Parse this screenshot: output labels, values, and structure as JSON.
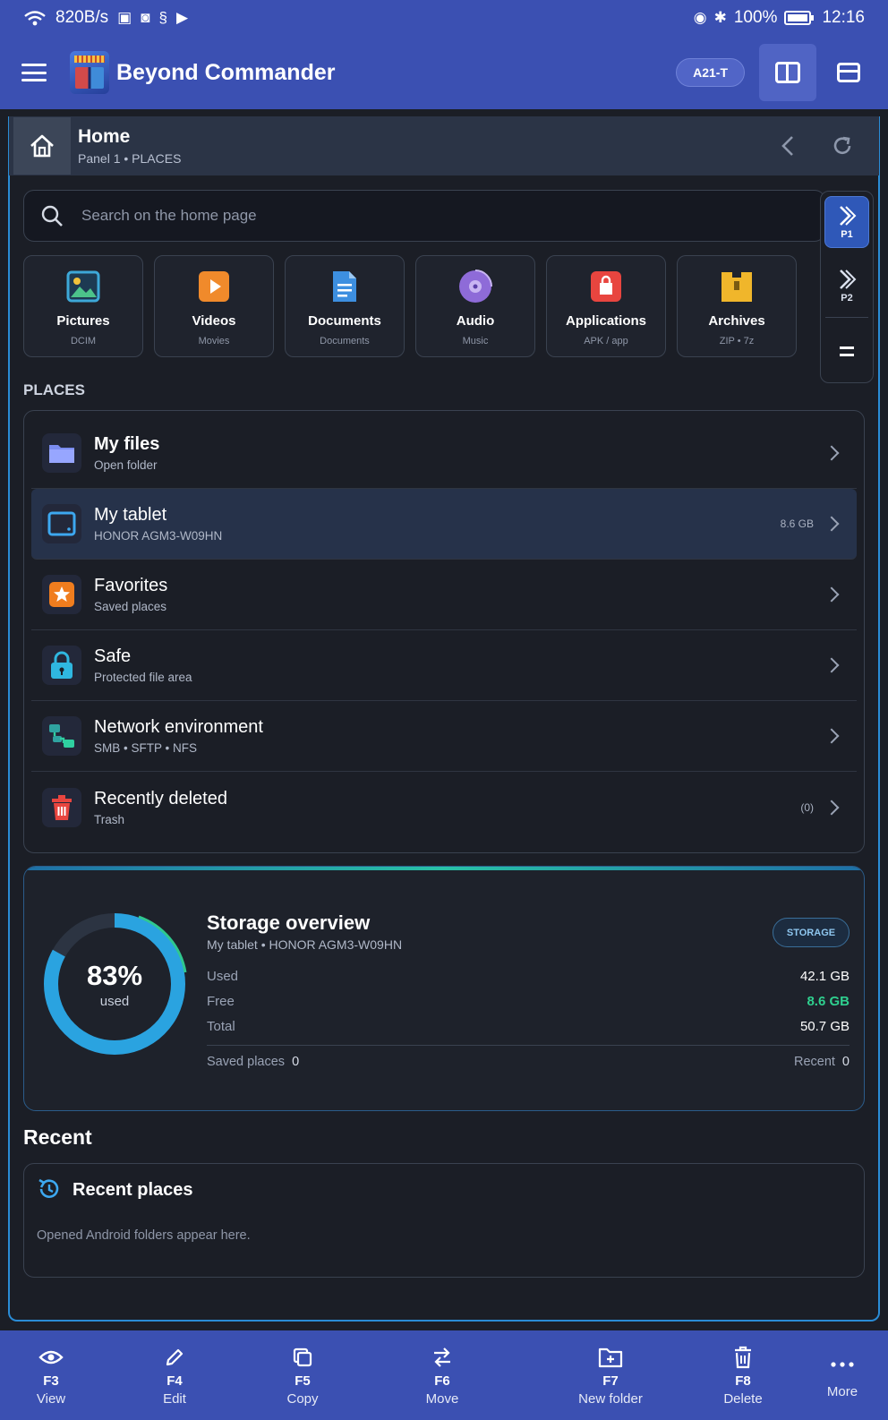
{
  "status_bar": {
    "net_speed": "820B/s",
    "battery": "100%",
    "time": "12:16"
  },
  "app": {
    "title": "Beyond Commander",
    "device_chip": "A21-T"
  },
  "panel": {
    "title": "Home",
    "subtitle": "Panel 1 • PLACES"
  },
  "search": {
    "placeholder": "Search on the home page"
  },
  "side_buttons": {
    "p1": "P1",
    "p2": "P2"
  },
  "tiles": [
    {
      "label": "Pictures",
      "sub": "DCIM",
      "icon": "pictures-icon",
      "color": "#3da8d8"
    },
    {
      "label": "Videos",
      "sub": "Movies",
      "icon": "videos-icon",
      "color": "#f08a2b"
    },
    {
      "label": "Documents",
      "sub": "Documents",
      "icon": "documents-icon",
      "color": "#3d8fe0"
    },
    {
      "label": "Audio",
      "sub": "Music",
      "icon": "audio-icon",
      "color": "#8e6bd8"
    },
    {
      "label": "Applications",
      "sub": "APK / app",
      "icon": "applications-icon",
      "color": "#e8453f"
    },
    {
      "label": "Archives",
      "sub": "ZIP • 7z",
      "icon": "archives-icon",
      "color": "#f0b62b"
    }
  ],
  "places_label": "PLACES",
  "places": [
    {
      "title": "My files",
      "sub": "Open folder",
      "meta": "",
      "icon": "folder-icon"
    },
    {
      "title": "My tablet",
      "sub": "HONOR AGM3-W09HN",
      "meta": "8.6 GB",
      "icon": "tablet-icon"
    },
    {
      "title": "Favorites",
      "sub": "Saved places",
      "meta": "",
      "icon": "star-icon"
    },
    {
      "title": "Safe",
      "sub": "Protected file area",
      "meta": "",
      "icon": "lock-icon"
    },
    {
      "title": "Network environment",
      "sub": "SMB • SFTP • NFS",
      "meta": "",
      "icon": "network-icon"
    },
    {
      "title": "Recently deleted",
      "sub": "Trash",
      "meta": "(0)",
      "icon": "trash-icon"
    }
  ],
  "storage": {
    "title": "Storage overview",
    "subtitle": "My tablet  •  HONOR AGM3-W09HN",
    "badge": "STORAGE",
    "percent_used": 83,
    "percent_text": "83%",
    "used_word": "used",
    "rows": [
      {
        "label": "Used",
        "value": "42.1 GB"
      },
      {
        "label": "Free",
        "value": "8.6 GB"
      },
      {
        "label": "Total",
        "value": "50.7 GB"
      }
    ],
    "saved_places_label": "Saved places",
    "saved_places_count": "0",
    "recent_label": "Recent",
    "recent_count": "0",
    "accent_color": "#2aa3e0",
    "free_color": "#2fd08f"
  },
  "recent": {
    "heading": "Recent",
    "card_title": "Recent places",
    "empty_text": "Opened Android folders appear here."
  },
  "bottom_bar": [
    {
      "code": "F3",
      "label": "View",
      "icon": "eye-icon"
    },
    {
      "code": "F4",
      "label": "Edit",
      "icon": "pencil-icon"
    },
    {
      "code": "F5",
      "label": "Copy",
      "icon": "copy-icon"
    },
    {
      "code": "F6",
      "label": "Move",
      "icon": "move-icon"
    },
    {
      "code": "F7",
      "label": "New folder",
      "icon": "new-folder-icon"
    },
    {
      "code": "F8",
      "label": "Delete",
      "icon": "delete-icon"
    },
    {
      "code": "",
      "label": "More",
      "icon": "more-icon"
    }
  ]
}
